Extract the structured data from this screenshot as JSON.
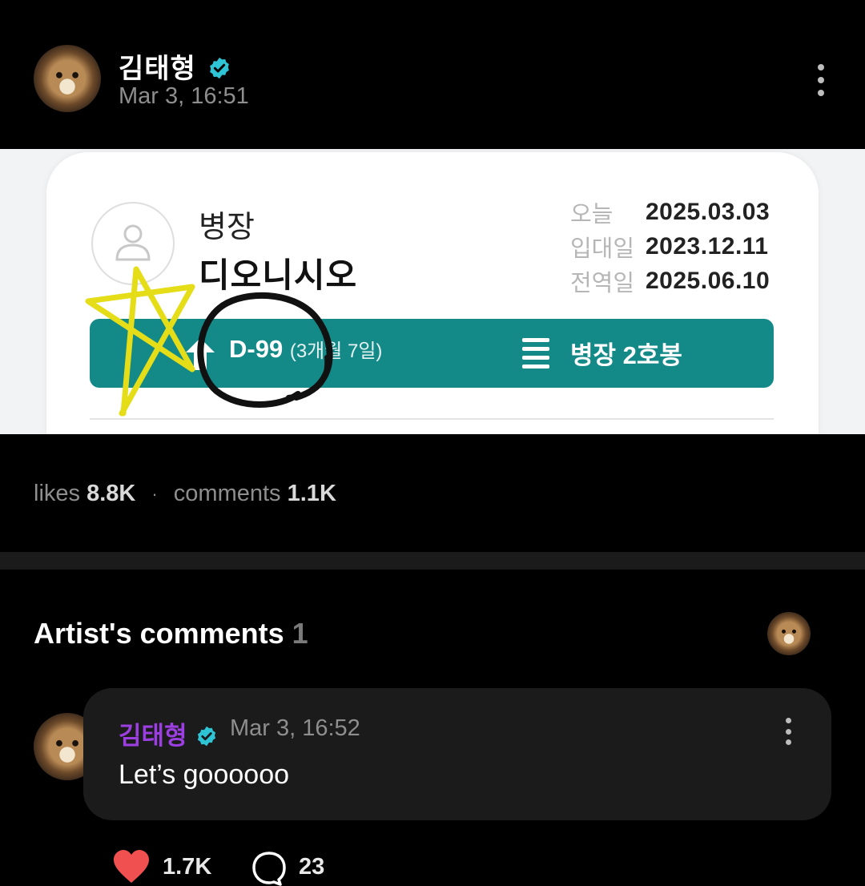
{
  "post": {
    "author": "김태형",
    "timestamp": "Mar 3, 16:51",
    "verified_icon": "verified-badge-icon",
    "more_icon": "more-vertical-icon"
  },
  "image": {
    "rank": "병장",
    "name": "디오니시오",
    "dates": [
      {
        "label": "오늘",
        "value": "2025.03.03"
      },
      {
        "label": "입대일",
        "value": "2023.12.11"
      },
      {
        "label": "전역일",
        "value": "2025.06.10"
      }
    ],
    "dday": "D-99",
    "dday_detail": "(3개월 7일)",
    "rank_step": "병장 2호봉",
    "annotations": [
      "yellow star drawing",
      "black circle drawing"
    ]
  },
  "stats": {
    "likes_label": "likes",
    "likes_value": "8.8K",
    "comments_label": "comments",
    "comments_value": "1.1K"
  },
  "artist_comments": {
    "title": "Artist's comments",
    "count": "1"
  },
  "comment": {
    "author": "김태형",
    "timestamp": "Mar 3, 16:52",
    "text": "Let’s goooooo",
    "likes": "1.7K",
    "replies": "23",
    "like_color": "#f0504f",
    "author_color": "#9b3fe0"
  },
  "colors": {
    "teal_bar": "#138a88",
    "verified": "#2ec4d6"
  }
}
